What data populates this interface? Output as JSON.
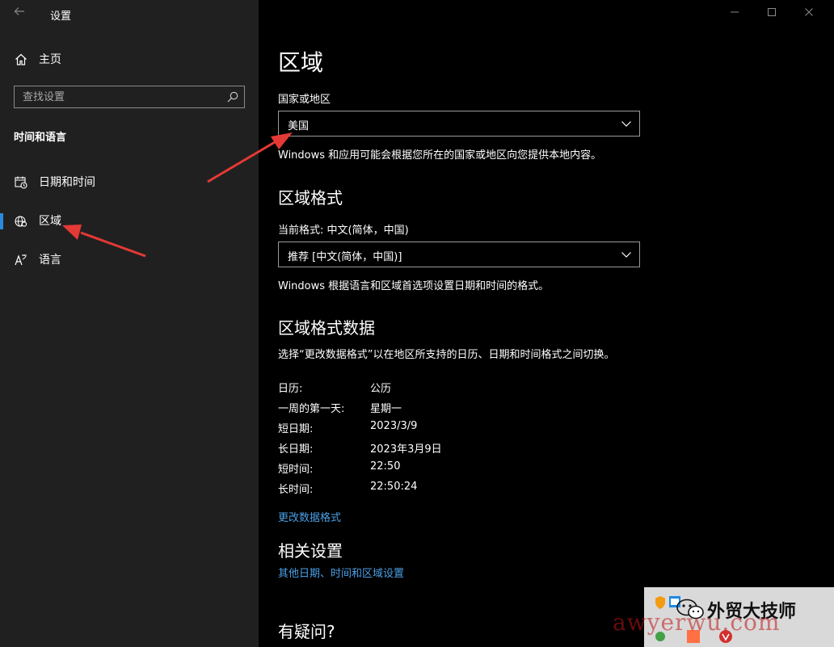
{
  "app": {
    "title": "设置"
  },
  "sidebar": {
    "home_label": "主页",
    "search_placeholder": "查找设置",
    "section_title": "时间和语言",
    "items": [
      {
        "label": "日期和时间",
        "icon": "calendar-clock-icon"
      },
      {
        "label": "区域",
        "icon": "globe-region-icon",
        "active": true
      },
      {
        "label": "语言",
        "icon": "language-icon"
      }
    ]
  },
  "main": {
    "title": "区域",
    "country": {
      "label": "国家或地区",
      "value": "美国",
      "description": "Windows 和应用可能会根据您所在的国家或地区向您提供本地内容。"
    },
    "format": {
      "heading": "区域格式",
      "current_label": "当前格式: 中文(简体，中国)",
      "value": "推荐 [中文(简体，中国)]",
      "description": "Windows 根据语言和区域首选项设置日期和时间的格式。"
    },
    "format_data": {
      "heading": "区域格式数据",
      "description": "选择“更改数据格式”以在地区所支持的日历、日期和时间格式之间切换。",
      "rows": [
        {
          "key": "日历:",
          "value": "公历"
        },
        {
          "key": "一周的第一天:",
          "value": "星期一"
        },
        {
          "key": "短日期:",
          "value": "2023/3/9"
        },
        {
          "key": "长日期:",
          "value": "2023年3月9日"
        },
        {
          "key": "短时间:",
          "value": "22:50"
        },
        {
          "key": "长时间:",
          "value": "22:50:24"
        }
      ],
      "change_link": "更改数据格式"
    },
    "related": {
      "heading": "相关设置",
      "link": "其他日期、时间和区域设置"
    },
    "question_heading": "有疑问?"
  },
  "watermark": {
    "brand": "外贸大技师",
    "url": "awyerwu.com"
  },
  "colors": {
    "accent": "#2a8bdc",
    "link": "#4c9fe7",
    "sidebar_bg": "#202020",
    "main_bg": "#000000",
    "annotation_arrow": "#e53935"
  }
}
